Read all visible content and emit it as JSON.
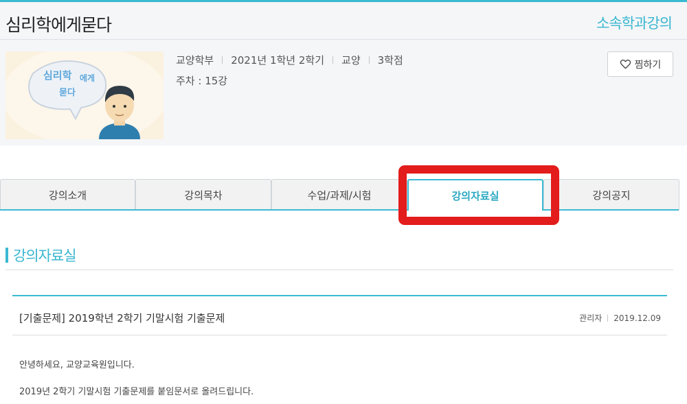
{
  "header": {
    "course_title": "심리학에게묻다",
    "dept_link": "소속학과강의"
  },
  "course_info": {
    "meta": [
      "교양학부",
      "2021년 1학년 2학기",
      "교양",
      "3학점"
    ],
    "weeks": "주차 : 15강",
    "wish_button": "찜하기",
    "thumbnail_text": [
      "심리학",
      "에게",
      "묻다"
    ]
  },
  "tabs": [
    {
      "label": "강의소개"
    },
    {
      "label": "강의목차"
    },
    {
      "label": "수업/과제/시험"
    },
    {
      "label": "강의자료실"
    },
    {
      "label": "강의공지"
    }
  ],
  "active_tab": 3,
  "section": {
    "title": "강의자료실"
  },
  "post": {
    "title": "[기출문제] 2019학년 2학기 기말시험 기출문제",
    "author": "관리자",
    "date": "2019.12.09",
    "body": [
      "안녕하세요, 교양교육원입니다.",
      "2019년 2학기 기말시험 기출문제를 붙임문서로 올려드립니다."
    ]
  },
  "colors": {
    "accent": "#3bb9d3",
    "highlight": "#e31c1c",
    "panel_bg": "#f4f6f8"
  }
}
